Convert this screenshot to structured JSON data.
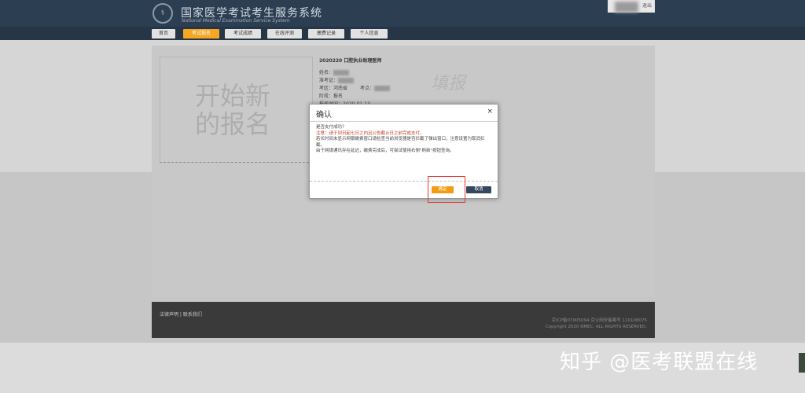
{
  "header": {
    "logo_text": "",
    "title": "国家医学考试考生服务系统",
    "subtitle": "National Medical Examination Service System",
    "user_action": "退出"
  },
  "nav": {
    "items": [
      {
        "label": "首页",
        "active": false
      },
      {
        "label": "考试报名",
        "active": true
      },
      {
        "label": "考试成绩",
        "active": false
      },
      {
        "label": "在线评测",
        "active": false
      },
      {
        "label": "缴费记录",
        "active": false
      },
      {
        "label": "个人信息",
        "active": false
      }
    ]
  },
  "main": {
    "start_label": "开始新的报名",
    "exam_title": "2020220 口腔执业助理医师",
    "fields": {
      "name_label": "姓名",
      "id_label": "准考证",
      "exam_area_label": "考区",
      "exam_area_value": "河南省",
      "exam_site_label": "考点",
      "stage_label": "阶段",
      "stage_value": "报名",
      "reg_time_label": "报名时间",
      "reg_time_value": "2020-01-13"
    },
    "fill_label": "填报"
  },
  "dialog": {
    "title": "确认",
    "close_icon": "×",
    "question": "是否支付成功？",
    "warning": "注意：请于到日起七日之内且公告截止日之前完成支付。",
    "note1": "若长时间未显示网银缴费窗口请检查当前浏览器是否拦截了弹出窗口，注意设置为取消拦截。",
    "note2": "由于网银通讯存在延迟，缴费完成后，可尝试使用右侧\"刷新\"按钮查询。",
    "ok_label": "确定",
    "cancel_label": "取消"
  },
  "footer": {
    "links": [
      "法律声明",
      "联系我们"
    ],
    "icp": "京ICP备07005094 京公网安备案号 110108075",
    "copyright": "Copyright 2020 NMEC. ALL RIGHTS RESERVED."
  },
  "watermark": "知乎 @医考联盟在线",
  "colors": {
    "header_bg": "#2b3e52",
    "accent": "#f39c12",
    "cancel_bg": "#34495e",
    "warning": "#c0392b",
    "highlight": "#e53935"
  }
}
